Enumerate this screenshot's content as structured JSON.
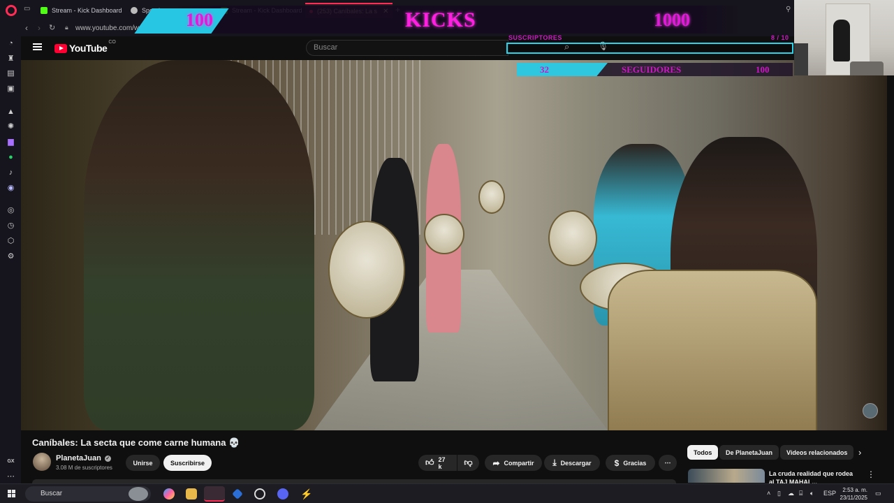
{
  "browser": {
    "tabs": [
      {
        "label": "Stream - Kick Dashboard",
        "favicon_color": "#53fc18"
      },
      {
        "label": "Speedtest",
        "favicon_color": "#bbbbbb"
      },
      {
        "label": "Stream - Kick Dashboard",
        "favicon_color": "#53fc18"
      },
      {
        "label": "(253) Caníbales: La s",
        "favicon_color": "#ff2d55"
      }
    ],
    "url": "www.youtube.com/watch"
  },
  "overlay": {
    "left_count": "100",
    "title": "KICKS",
    "right_count": "1000",
    "subs_label": "SUSCRIPTORES",
    "subs_progress": "8 / 10",
    "followers_value": "32",
    "followers_label": "SEGUIDORES",
    "followers_goal": "100",
    "accent": "#ff1fe0",
    "bar_color": "#29d3ea"
  },
  "youtube": {
    "logo": "YouTube",
    "country": "CO",
    "search_placeholder": "Buscar",
    "video_title": "Caníbales: La secta que come carne humana 💀",
    "channel": {
      "name": "PlanetaJuan",
      "subscribers": "3.08 M de suscriptores",
      "join_label": "Unirse",
      "subscribe_label": "Suscribirse"
    },
    "actions": {
      "likes": "27 k",
      "share": "Compartir",
      "download": "Descargar",
      "thanks": "Gracias"
    },
    "chips": [
      "Todos",
      "De PlanetaJuan",
      "Videos relacionados"
    ],
    "recommendation": {
      "title": "La cruda realidad que rodea al TAJ MAHAL..."
    }
  },
  "taskbar": {
    "search_label": "Buscar",
    "language": "ESP",
    "time": "2:53 a. m.",
    "date": "23/11/2025"
  },
  "sidebar": {
    "gx_label": "GX"
  }
}
